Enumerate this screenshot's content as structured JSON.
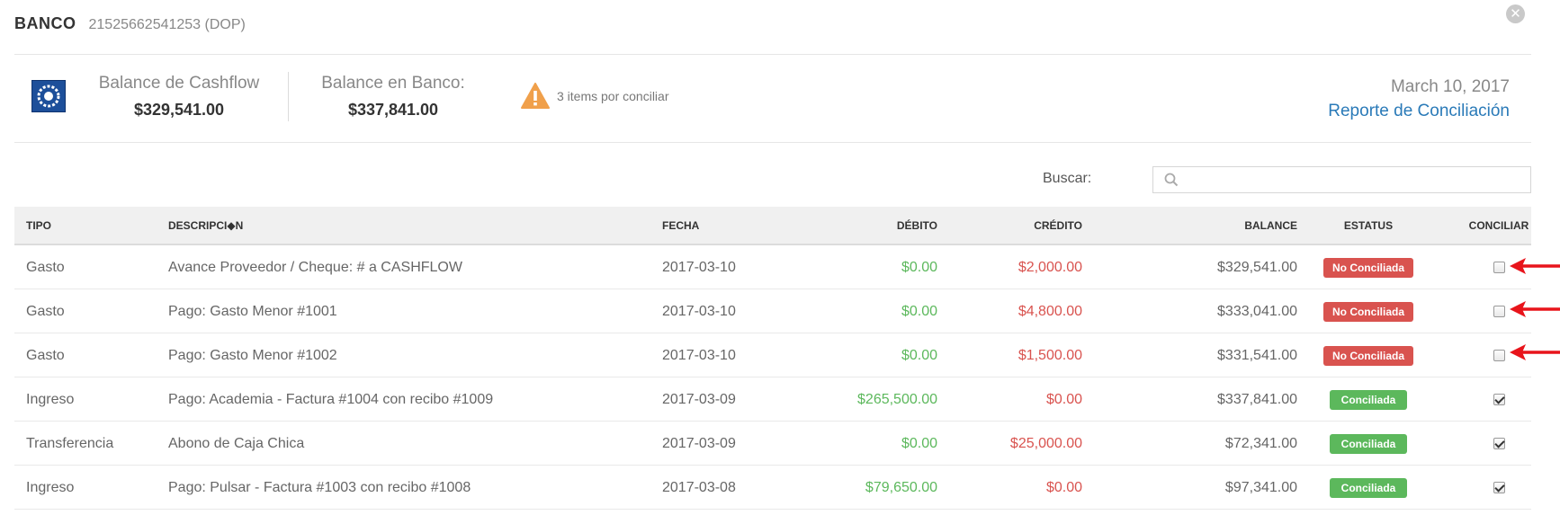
{
  "header": {
    "bank_name": "BANCO",
    "account": "21525662541253 (DOP)"
  },
  "summary": {
    "cashflow_label": "Balance de Cashflow",
    "cashflow_value": "$329,541.00",
    "bank_label": "Balance en Banco:",
    "bank_value": "$337,841.00",
    "pending_text": "3 items por conciliar",
    "date": "March 10, 2017",
    "report_link": "Reporte de Conciliación"
  },
  "search": {
    "label": "Buscar:",
    "placeholder": "",
    "value": ""
  },
  "table": {
    "headers": {
      "tipo": "TIPO",
      "descripcion": "DESCRIPCI◆N",
      "fecha": "FECHA",
      "debito": "DÉBITO",
      "credito": "CRÉDITO",
      "balance": "BALANCE",
      "estatus": "ESTATUS",
      "conciliar": "CONCILIAR"
    },
    "rows": [
      {
        "tipo": "Gasto",
        "descripcion": "Avance Proveedor / Cheque: # a CASHFLOW",
        "fecha": "2017-03-10",
        "debito": "$0.00",
        "credito": "$2,000.00",
        "balance": "$329,541.00",
        "estatus": "No Conciliada",
        "conciliado": false
      },
      {
        "tipo": "Gasto",
        "descripcion": "Pago: Gasto Menor #1001",
        "fecha": "2017-03-10",
        "debito": "$0.00",
        "credito": "$4,800.00",
        "balance": "$333,041.00",
        "estatus": "No Conciliada",
        "conciliado": false
      },
      {
        "tipo": "Gasto",
        "descripcion": "Pago: Gasto Menor #1002",
        "fecha": "2017-03-10",
        "debito": "$0.00",
        "credito": "$1,500.00",
        "balance": "$331,541.00",
        "estatus": "No Conciliada",
        "conciliado": false
      },
      {
        "tipo": "Ingreso",
        "descripcion": "Pago: Academia - Factura #1004 con recibo #1009",
        "fecha": "2017-03-09",
        "debito": "$265,500.00",
        "credito": "$0.00",
        "balance": "$337,841.00",
        "estatus": "Conciliada",
        "conciliado": true
      },
      {
        "tipo": "Transferencia",
        "descripcion": "Abono de Caja Chica",
        "fecha": "2017-03-09",
        "debito": "$0.00",
        "credito": "$25,000.00",
        "balance": "$72,341.00",
        "estatus": "Conciliada",
        "conciliado": true
      },
      {
        "tipo": "Ingreso",
        "descripcion": "Pago: Pulsar - Factura #1003 con recibo #1008",
        "fecha": "2017-03-08",
        "debito": "$79,650.00",
        "credito": "$0.00",
        "balance": "$97,341.00",
        "estatus": "Conciliada",
        "conciliado": true
      }
    ]
  },
  "colors": {
    "debit": "#5cb85c",
    "credit": "#d9534f",
    "badge_no": "#d9534f",
    "badge_ok": "#5cb85c",
    "link": "#2a7ab8",
    "warning": "#f0a04b",
    "annotation_arrow": "#e8141b"
  },
  "icons": {
    "close": "close-icon",
    "logo": "bank-logo",
    "warning": "warning-icon",
    "search": "search-icon",
    "arrow": "arrow-left-icon"
  }
}
